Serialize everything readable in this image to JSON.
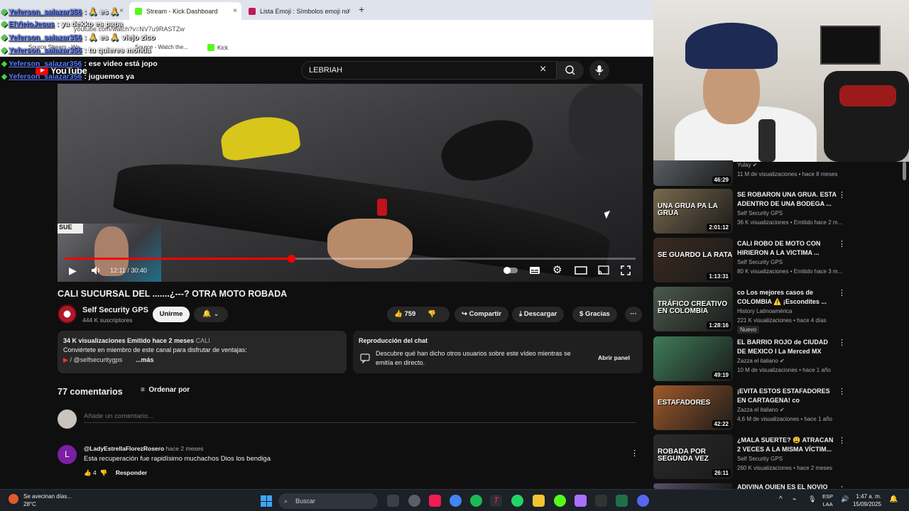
{
  "browser": {
    "tabs": [
      {
        "label": "",
        "close": "×"
      },
      {
        "label": "Stream - Kick Dashboard",
        "close": "×"
      },
      {
        "label": "Lista Emoji : Símbolos emoji nu",
        "close": "×"
      }
    ],
    "new_tab": "+",
    "url": "youtube.com/watch?v=NV7u9RASTZw",
    "bookmarks": [
      "Source Stream - Wa...",
      "Source - Watch the...",
      "Kick"
    ]
  },
  "chat_overlay": [
    {
      "user": "Yeferson_salazar356",
      "message": ": 🙏 es 🙏"
    },
    {
      "user": "ElViejoJesus",
      "message": ": ya dekko es papa"
    },
    {
      "user": "Yeferson_salazar356",
      "message": ": 🙏 es 🙏 viejo zico"
    },
    {
      "user": "Yeferson_salazar356",
      "message": ": tu quieres monda"
    },
    {
      "user": "Yeferson_salazar356",
      "message": ": ese video está jopo"
    },
    {
      "user": "Yeferson_salazar356",
      "message": ": juguemos ya"
    }
  ],
  "youtube": {
    "logo": "YouTube",
    "search_value": "LEBRIAH",
    "search_clear": "×",
    "player": {
      "time": "12:11 / 30:40",
      "progress": 0.397,
      "pip_sign": "SUE"
    },
    "video": {
      "title": "CALI SUCURSAL DEL .......¿---? OTRA MOTO ROBADA",
      "channel": "Self Security GPS",
      "subscribers": "444 K suscriptores",
      "join_label": "Unirme",
      "likes": "759",
      "share_label": "Compartir",
      "download_label": "Descargar",
      "thanks_label": "Gracias",
      "more_label": "···"
    },
    "description": {
      "views_date": "34 K visualizaciones  Emitido hace 2 meses",
      "location": "CALI",
      "line": "Conviértete en miembro de este canal para disfrutar de ventajas:",
      "link": "/ @selfsecuritygps",
      "more": "...más"
    },
    "chat_replay": {
      "title": "Reproducción del chat",
      "desc": "Descubre qué han dicho otros usuarios sobre este vídeo mientras se emitía en directo.",
      "button": "Abrir panel"
    },
    "comments": {
      "count": "77 comentarios",
      "sort_label": "Ordenar por",
      "add_placeholder": "Añade un comentario...",
      "items": [
        {
          "initial": "L",
          "author": "@LadyEstrellaFlorezRosero",
          "time": "hace 2 meses",
          "text": "Esta recuperación fue rapidísimo muchachos Dios los bendiga",
          "likes": "4",
          "reply_label": "Responder"
        }
      ]
    }
  },
  "recommendations": [
    {
      "title": "",
      "channel": "Yulay ✔",
      "meta": "11 M de visualizaciones • hace 8 meses",
      "duration": "46:29",
      "thumb_text": "",
      "color": "#5a5f66",
      "badge": ""
    },
    {
      "title": "SE ROBARON UNA GRUA. ESTA ADENTRO DE UNA BODEGA ...",
      "channel": "Self Security GPS",
      "meta": "36 K visualizaciones • Emitido hace 2 m...",
      "duration": "2:01:12",
      "thumb_text": "UNA GRUA PA LA GRUA",
      "color": "#7a6a4e",
      "badge": ""
    },
    {
      "title": "CALI ROBO DE MOTO CON HIRIERON A LA VICTIMA ...",
      "channel": "Self Security GPS",
      "meta": "80 K visualizaciones • Emitido hace 3 m...",
      "duration": "1:13:31",
      "thumb_text": "SE GUARDO LA RATA",
      "color": "#3a2a20",
      "badge": ""
    },
    {
      "title": "co Los mejores casos de COLOMBIA ⚠️ ¡Escondites ...",
      "channel": "History Latinoamérica",
      "meta": "221 K visualizaciones • hace 4 días",
      "duration": "1:28:16",
      "thumb_text": "TRÁFICO CREATIVO EN COLOMBIA",
      "color": "#4b5a4c",
      "badge": "Nuevo"
    },
    {
      "title": "EL BARRIO ROJO de CIUDAD DE MEXICO l La Merced MX",
      "channel": "Zazza el italiano ✔",
      "meta": "10 M de visualizaciones • hace 1 año",
      "duration": "49:19",
      "thumb_text": "",
      "color": "#3f7d5a",
      "badge": ""
    },
    {
      "title": "¡EVITA ESTOS ESTAFADORES EN CARTAGENA! co",
      "channel": "Zazza el italiano ✔",
      "meta": "4,6 M de visualizaciones • hace 1 año",
      "duration": "42:22",
      "thumb_text": "ESTAFADORES",
      "color": "#a05a2a",
      "badge": ""
    },
    {
      "title": "¿MALA SUERTE? 😩 ATRACAN 2 VECES A LA MISMA VÍCTIM...",
      "channel": "Self Security GPS",
      "meta": "260 K visualizaciones • hace 2 meses",
      "duration": "26:11",
      "thumb_text": "ROBADA POR SEGUNDA VEZ",
      "color": "#2a2a2a",
      "badge": ""
    },
    {
      "title": "ADIVINA QUIEN ES EL NOVIO",
      "channel": "",
      "meta": "",
      "duration": "",
      "thumb_text": "",
      "color": "#5a4f6a",
      "badge": ""
    }
  ],
  "taskbar": {
    "weather_text": "Se avecinan días...",
    "temperature": "28°C",
    "search_label": "Buscar",
    "lang": "ESP",
    "lang2": "LAA",
    "time": "1:47 a. m.",
    "date": "15/09/2025"
  }
}
